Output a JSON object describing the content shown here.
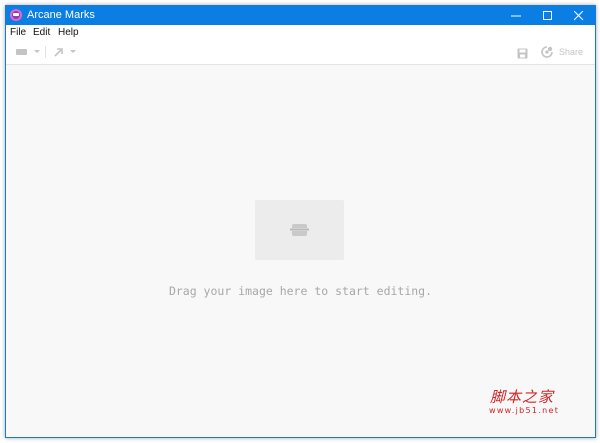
{
  "window": {
    "title": "Arcane Marks",
    "accent_color": "#0a7ee2",
    "controls": {
      "minimize_icon": "minimize-icon",
      "maximize_icon": "maximize-icon",
      "close_icon": "close-icon"
    }
  },
  "menu": {
    "items": [
      {
        "label": "File"
      },
      {
        "label": "Edit"
      },
      {
        "label": "Help"
      }
    ]
  },
  "toolbar": {
    "shape_tool_icon": "rectangle-icon",
    "arrow_tool_icon": "arrow-icon",
    "save_icon": "save-icon",
    "share_icon": "share-icon",
    "share_label": "Share"
  },
  "canvas": {
    "placeholder_icon": "image-placeholder-icon",
    "empty_message": "Drag your image here to start editing."
  },
  "watermark": {
    "chinese_text": "脚本之家",
    "url_text": "www.jb51.net",
    "color": "#d62222"
  }
}
